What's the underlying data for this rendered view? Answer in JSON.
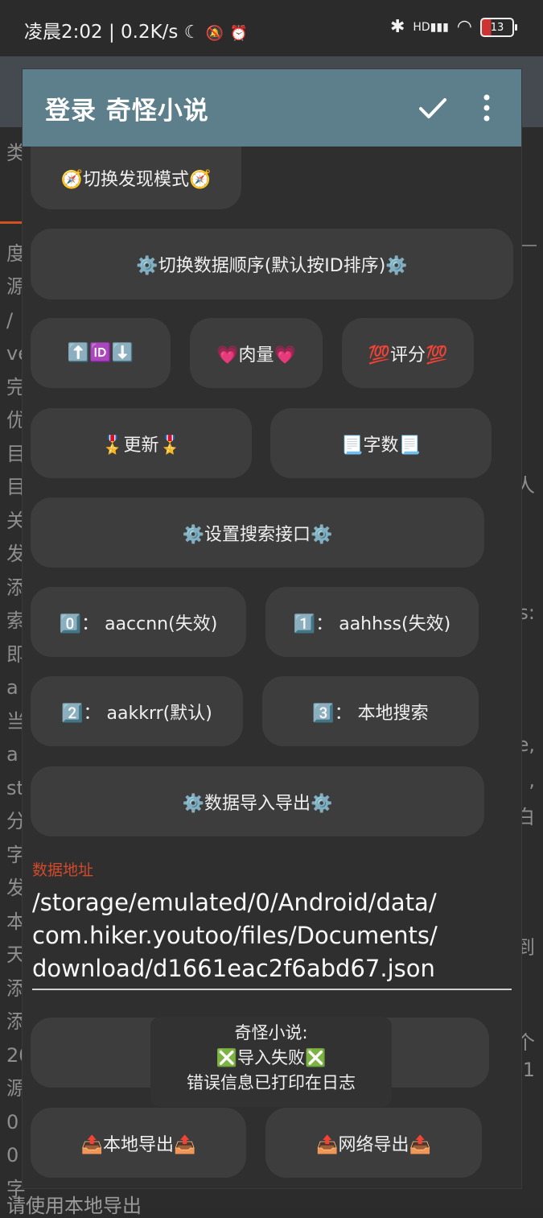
{
  "status_bar": {
    "time_speed": "凌晨2:02 | 0.2K/s",
    "moon_icon": "☾",
    "bell_icon": "🔕",
    "alarm_icon": "⏰",
    "bluetooth_icon": "✱",
    "signal_icon": "HD▮▮▮",
    "wifi_icon": "◠",
    "battery": "13"
  },
  "background_page": {
    "left_chars": [
      "类",
      "",
      "",
      "度",
      "源",
      "/",
      "ve",
      "完",
      "优",
      "目",
      "目",
      "关",
      "发",
      "添",
      "索",
      "即",
      "a",
      "当",
      "a",
      "st",
      "分",
      "字",
      "发",
      "本",
      "天",
      "添",
      "添",
      "20",
      "源",
      "0",
      "0",
      "字"
    ],
    "right_chars": [
      "人",
      "s:",
      "e,",
      ",",
      "白",
      "到",
      "个",
      "1"
    ],
    "bottom_line": "请使用本地导出"
  },
  "dialog": {
    "title": "登录 奇怪小说",
    "buttons": {
      "discover_mode": "🧭切换发现模式🧭",
      "data_order": "⚙️切换数据顺序(默认按ID排序)⚙️",
      "sort_id": "⬆️🆔⬇️",
      "sort_meat": "💗肉量💗",
      "sort_score": "💯评分💯",
      "sort_update": "🎖️更新🎖️",
      "sort_words": "📃字数📃",
      "search_api": "⚙️设置搜索接口⚙️",
      "api_0": "0️⃣：  aaccnn(失效)",
      "api_1": "1️⃣：  aahhss(失效)",
      "api_2": "2️⃣：  aakkrr(默认)",
      "api_3": "3️⃣：  本地搜索",
      "data_io": "⚙️数据导入导出⚙️",
      "local_export": "📤本地导出📤",
      "network_export": "📤网络导出📤"
    },
    "data_address": {
      "label": "数据地址",
      "lines": [
        "/storage/emulated/0/Android/data/",
        "com.hiker.youtoo/files/Documents/",
        "download/d1661eac2f6abd67.json"
      ]
    }
  },
  "toast": {
    "line1": "奇怪小说:",
    "line2": "❎导入失败❎",
    "line3": "错误信息已打印在日志"
  }
}
